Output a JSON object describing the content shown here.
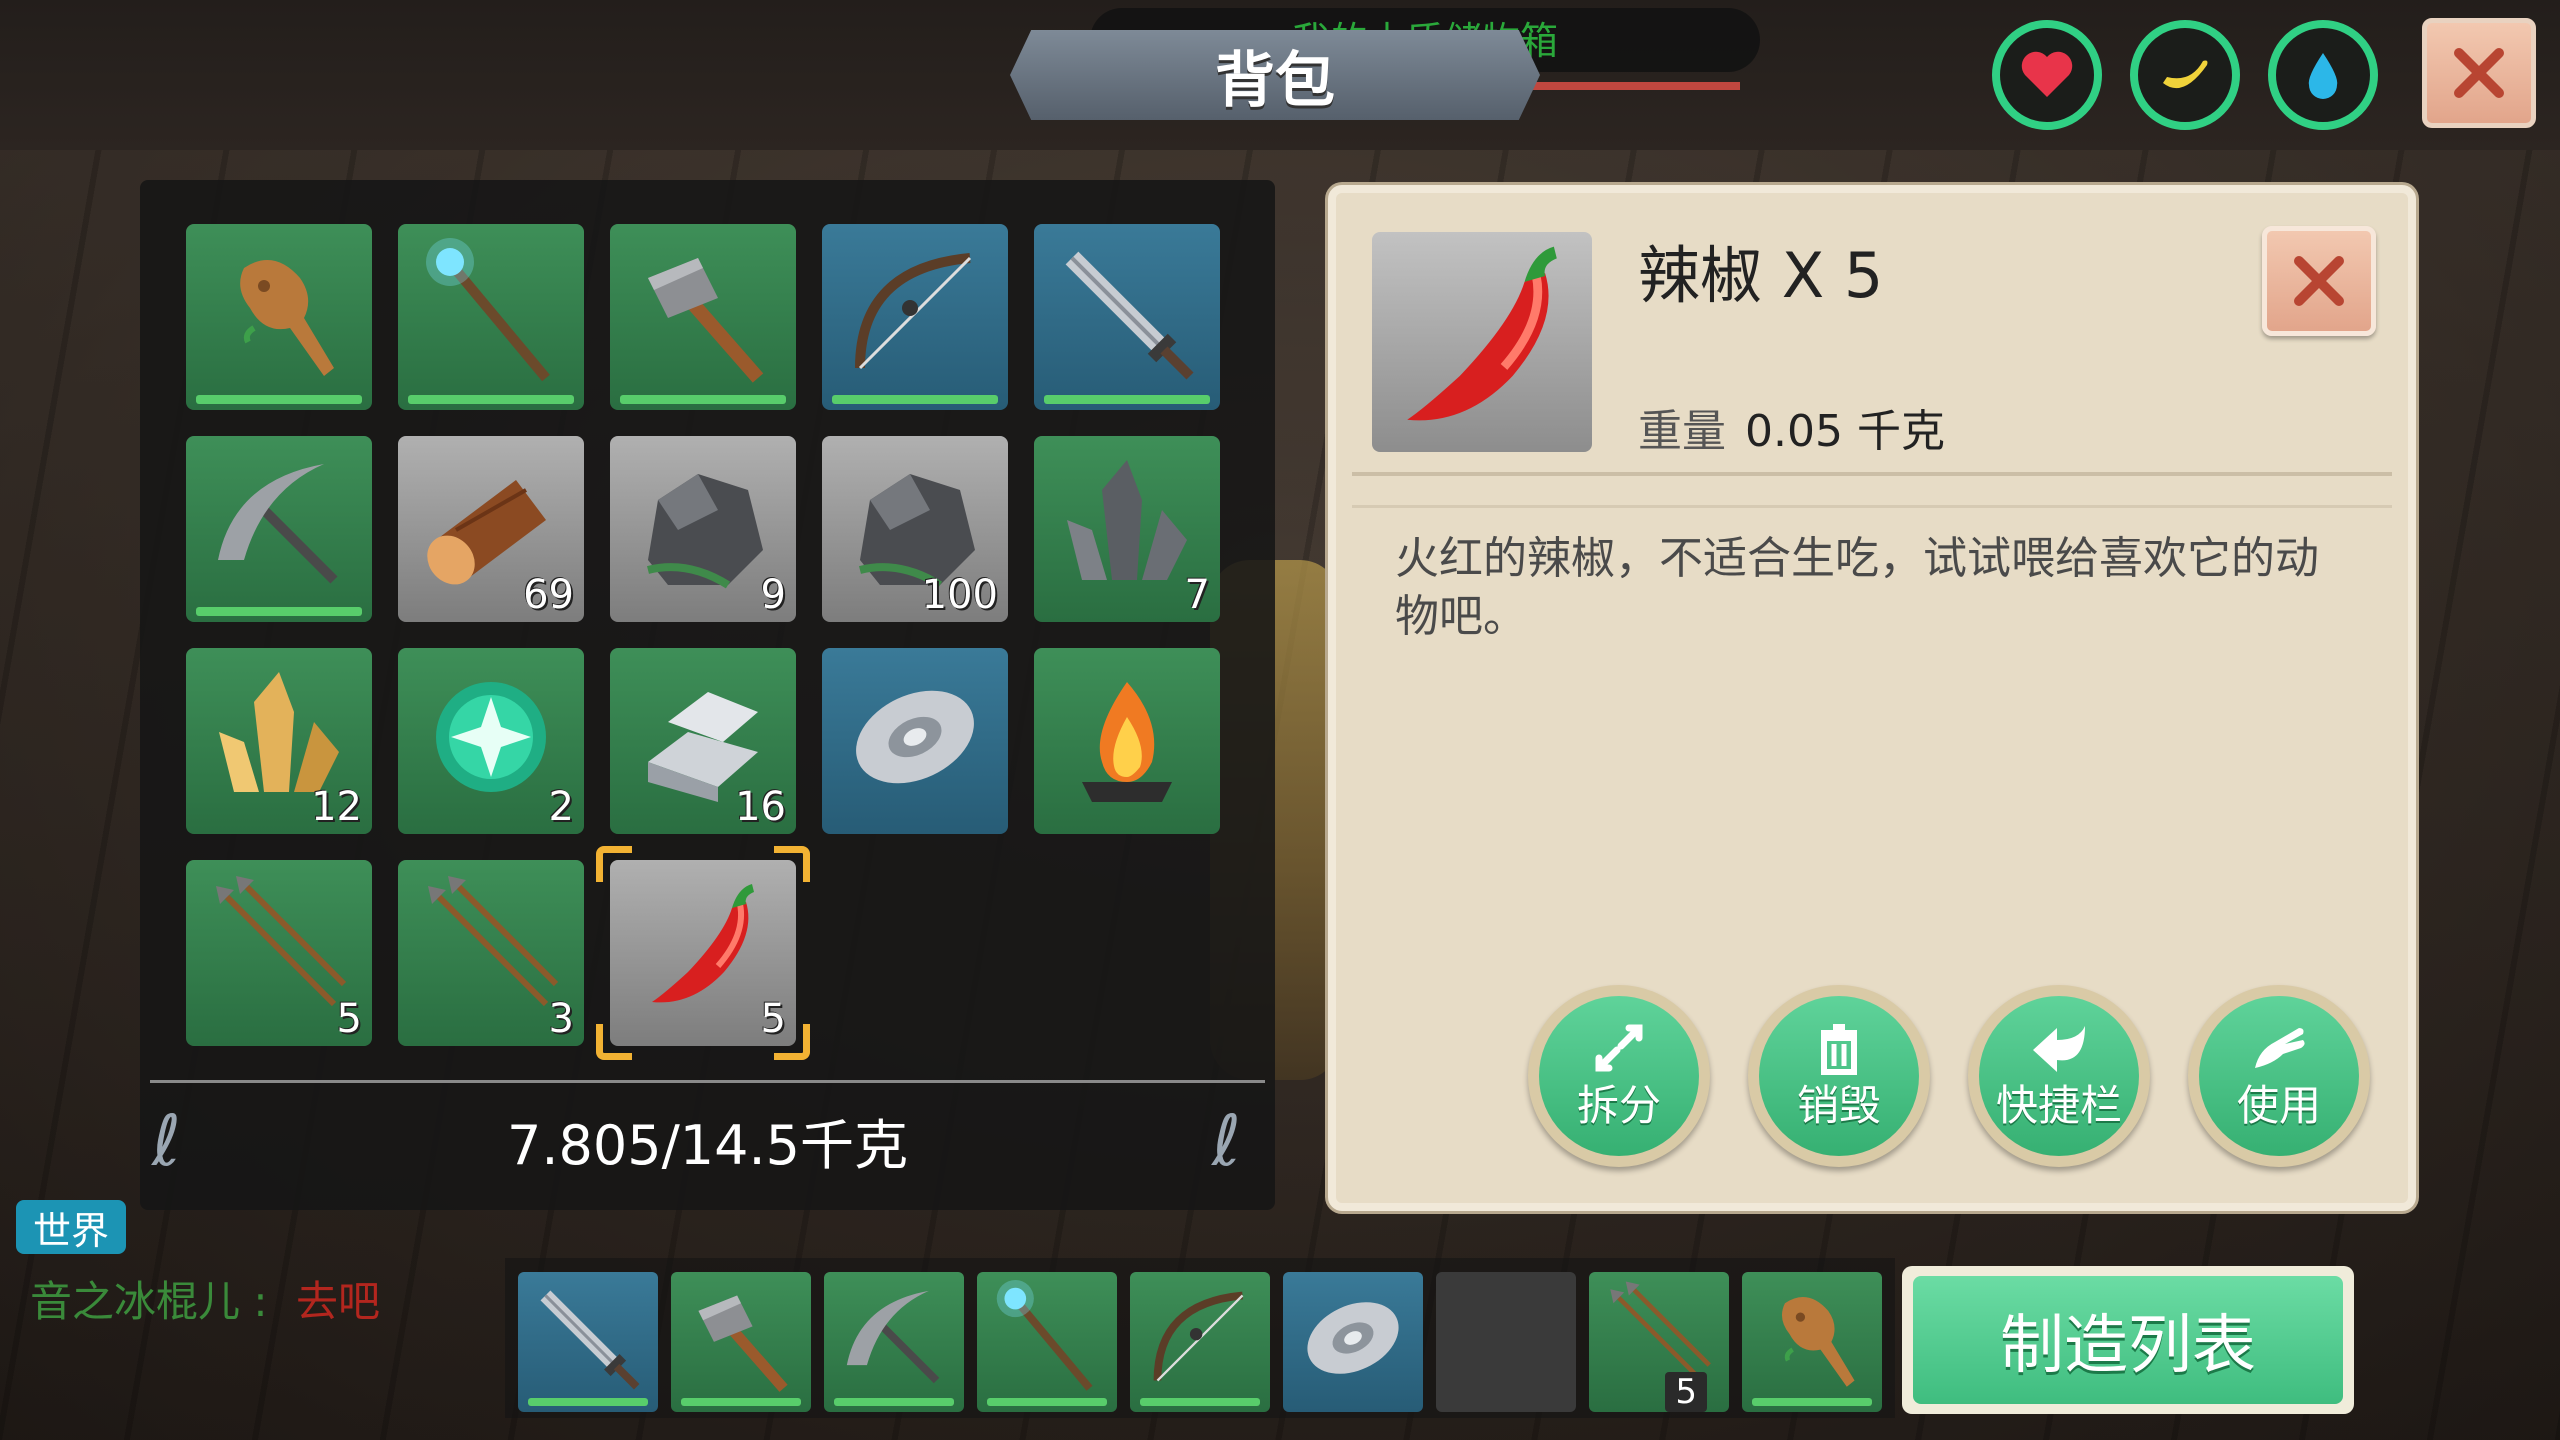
{
  "storage_title": "我的木质储物箱",
  "panel_title": "背包",
  "stats": [
    {
      "name": "health",
      "icon": "heart-icon",
      "color": "#e8344a"
    },
    {
      "name": "hunger",
      "icon": "banana-icon",
      "color": "#f0d23a"
    },
    {
      "name": "thirst",
      "icon": "water-drop-icon",
      "color": "#2cb7e8"
    }
  ],
  "inventory": {
    "weight": "7.805/14.5千克",
    "slots": [
      {
        "item": "wooden-club",
        "count": "",
        "bg": "green",
        "durability": true
      },
      {
        "item": "magic-staff",
        "count": "",
        "bg": "green",
        "durability": true
      },
      {
        "item": "stone-hammer",
        "count": "",
        "bg": "green",
        "durability": true
      },
      {
        "item": "bow",
        "count": "",
        "bg": "blue",
        "durability": true
      },
      {
        "item": "iron-sword",
        "count": "",
        "bg": "blue",
        "durability": true
      },
      {
        "item": "pickaxe",
        "count": "",
        "bg": "green",
        "durability": true
      },
      {
        "item": "wood-log",
        "count": "69",
        "bg": "gray",
        "durability": false
      },
      {
        "item": "stone",
        "count": "9",
        "bg": "gray",
        "durability": false
      },
      {
        "item": "stone",
        "count": "100",
        "bg": "gray",
        "durability": false
      },
      {
        "item": "dark-crystal",
        "count": "7",
        "bg": "green",
        "durability": false
      },
      {
        "item": "gold-crystal",
        "count": "12",
        "bg": "green",
        "durability": false
      },
      {
        "item": "green-orb",
        "count": "2",
        "bg": "green",
        "durability": false
      },
      {
        "item": "iron-ingot",
        "count": "16",
        "bg": "green",
        "durability": false
      },
      {
        "item": "shield-disc",
        "count": "",
        "bg": "blue",
        "durability": false
      },
      {
        "item": "campfire",
        "count": "",
        "bg": "green",
        "durability": false
      },
      {
        "item": "arrows",
        "count": "5",
        "bg": "green",
        "durability": false
      },
      {
        "item": "arrows",
        "count": "3",
        "bg": "green",
        "durability": false
      },
      {
        "item": "chili-pepper",
        "count": "5",
        "bg": "gray",
        "durability": false,
        "selected": true
      }
    ]
  },
  "detail": {
    "name": "辣椒 X 5",
    "weight_label": "重量",
    "weight_value": "0.05 千克",
    "description": "火红的辣椒，不适合生吃，试试喂给喜欢它的动物吧。",
    "actions": [
      {
        "label": "拆分",
        "icon": "split-arrows-icon"
      },
      {
        "label": "销毁",
        "icon": "trash-icon"
      },
      {
        "label": "快捷栏",
        "icon": "back-arrow-icon"
      },
      {
        "label": "使用",
        "icon": "hand-icon"
      }
    ]
  },
  "chat": {
    "channel": "世界",
    "sender": "音之冰棍儿 : ",
    "message": "去吧"
  },
  "hotbar": [
    {
      "item": "iron-sword",
      "count": "",
      "bg": "blue",
      "durability": true
    },
    {
      "item": "stone-hammer",
      "count": "",
      "bg": "green",
      "durability": true
    },
    {
      "item": "pickaxe",
      "count": "",
      "bg": "green",
      "durability": true
    },
    {
      "item": "magic-staff",
      "count": "",
      "bg": "green",
      "durability": true
    },
    {
      "item": "bow",
      "count": "",
      "bg": "green",
      "durability": true
    },
    {
      "item": "shield-disc",
      "count": "",
      "bg": "blue",
      "durability": false
    },
    {
      "item": "empty",
      "count": "",
      "bg": "empty",
      "durability": false
    },
    {
      "item": "arrows",
      "count": "5",
      "bg": "green",
      "durability": false
    },
    {
      "item": "wooden-club",
      "count": "",
      "bg": "green",
      "durability": true
    }
  ],
  "craft_button": "制造列表"
}
